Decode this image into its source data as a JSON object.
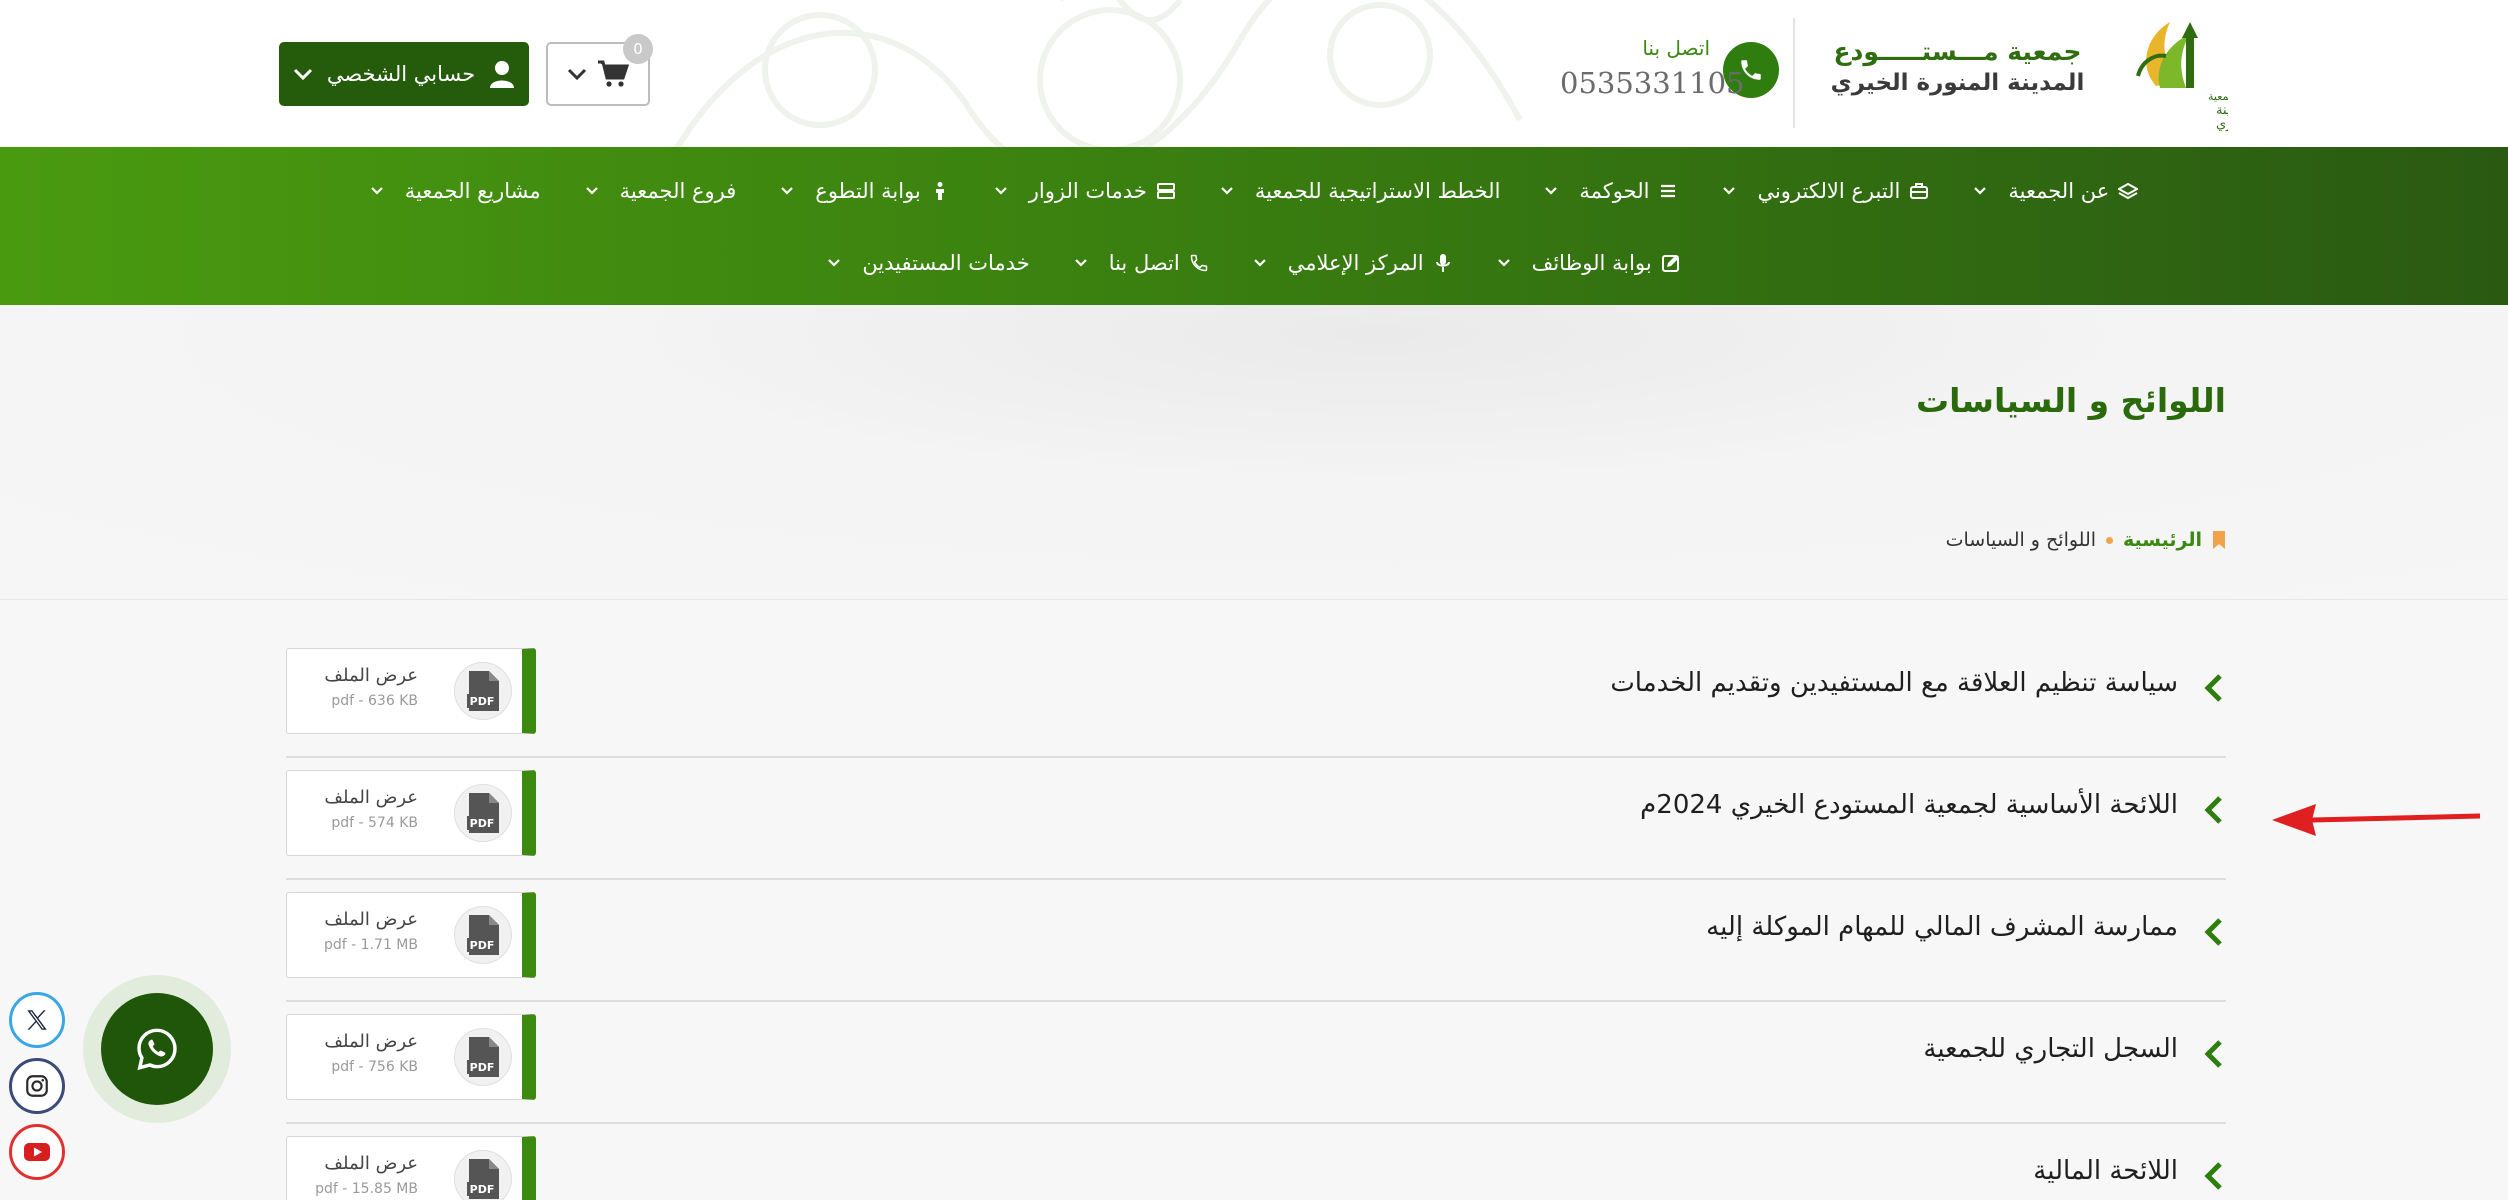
{
  "header": {
    "logo_lines": [
      "جمعية",
      "مستودع المدينة",
      "المنورة الخيري"
    ],
    "org_name_line1": "جمعية مـــستـــــودع",
    "org_name_line2": "المدينة المنورة الخيري",
    "contact_label": "اتصل بنا",
    "contact_phone": "0535331105",
    "account_label": "حسابي الشخصي",
    "cart_count": "0"
  },
  "nav": {
    "row1": [
      {
        "label": "عن الجمعية",
        "icon": "layers-icon"
      },
      {
        "label": "التبرع الالكتروني",
        "icon": "briefcase-icon"
      },
      {
        "label": "الحوكمة",
        "icon": "list-icon"
      },
      {
        "label": "الخطط الاستراتيجية للجمعية",
        "icon": ""
      },
      {
        "label": "خدمات الزوار",
        "icon": "server-icon"
      },
      {
        "label": "بوابة التطوع",
        "icon": "person-icon"
      },
      {
        "label": "فروع الجمعية",
        "icon": ""
      },
      {
        "label": "مشاريع الجمعية",
        "icon": ""
      }
    ],
    "row2": [
      {
        "label": "بوابة الوظائف",
        "icon": "edit-icon"
      },
      {
        "label": "المركز الإعلامي",
        "icon": "microphone-icon"
      },
      {
        "label": "اتصل بنا",
        "icon": "phone-icon"
      },
      {
        "label": "خدمات المستفيدين",
        "icon": ""
      }
    ]
  },
  "hero": {
    "title": "اللوائح و السياسات",
    "breadcrumb_home": "الرئيسية",
    "breadcrumb_current": "اللوائح و السياسات"
  },
  "documents": [
    {
      "title": "سياسة تنظيم العلاقة مع المستفيدين وتقديم الخدمات",
      "file_label": "عرض الملف",
      "file_meta": "pdf - 636 KB"
    },
    {
      "title": "اللائحة الأساسية لجمعية المستودع الخيري 2024م",
      "file_label": "عرض الملف",
      "file_meta": "pdf - 574 KB"
    },
    {
      "title": "ممارسة المشرف المالي للمهام الموكلة إليه",
      "file_label": "عرض الملف",
      "file_meta": "pdf - 1.71 MB"
    },
    {
      "title": "السجل التجاري للجمعية",
      "file_label": "عرض الملف",
      "file_meta": "pdf - 756 KB"
    },
    {
      "title": "اللائحة المالية",
      "file_label": "عرض الملف",
      "file_meta": "pdf - 15.85 MB"
    }
  ],
  "pdf_icon_text": "PDF",
  "colors": {
    "brand_green": "#3d8a10",
    "dark_green": "#245c0c",
    "title_green": "#2a6a0c",
    "arrow_red": "#e02020"
  }
}
